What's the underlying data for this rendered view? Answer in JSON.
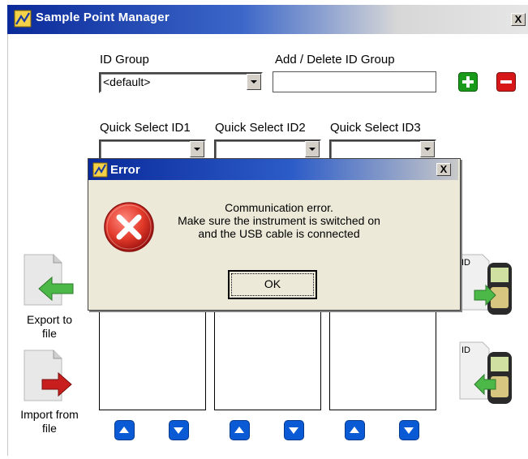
{
  "window": {
    "title": "Sample Point Manager",
    "close": "X"
  },
  "id_group": {
    "label": "ID Group",
    "selected": "<default>",
    "add_delete_label": "Add / Delete ID Group",
    "add_delete_value": "",
    "add_icon": "plus-icon",
    "delete_icon": "minus-icon"
  },
  "quick_select": [
    {
      "label": "Quick Select ID1",
      "value": ""
    },
    {
      "label": "Quick Select ID2",
      "value": ""
    },
    {
      "label": "Quick Select ID3",
      "value": ""
    }
  ],
  "side": {
    "export_label": "Export to file",
    "import_label": "Import from file",
    "device_badge": "ID"
  },
  "error_dialog": {
    "title": "Error",
    "close": "X",
    "message_line1": "Communication error.",
    "message_line2": "Make sure the instrument is switched on",
    "message_line3": "and the USB cable is connected",
    "ok_label": "OK",
    "icon": "error-x-icon"
  },
  "colors": {
    "titlebar": "#0a2a9a",
    "add_green": "#1a9a1a",
    "delete_red": "#d81818",
    "arrow_blue": "#0a5ad6",
    "export_green": "#4cb848",
    "import_red": "#c81e1e"
  }
}
